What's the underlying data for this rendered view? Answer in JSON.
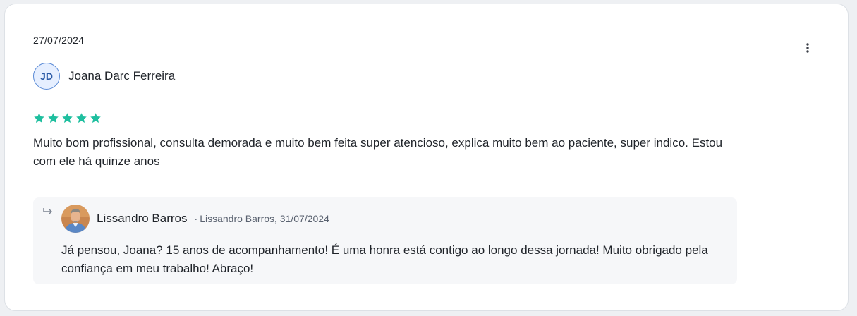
{
  "review": {
    "date": "27/07/2024",
    "author_initials": "JD",
    "author_name": "Joana Darc Ferreira",
    "rating": 5,
    "rating_max": 5,
    "text": "Muito bom profissional, consulta demorada e muito bem feita super atencioso, explica muito bem ao paciente, super indico. Estou com ele há quinze anos"
  },
  "reply": {
    "author_name": "Lissandro Barros",
    "meta_separator": "·",
    "meta": "Lissandro Barros, 31/07/2024",
    "text": "Já pensou, Joana? 15 anos de acompanhamento! É uma honra está contigo ao longo dessa jornada! Muito obrigado pela confiança em meu trabalho! Abraço!"
  },
  "icons": {
    "menu": "more-vertical-icon",
    "star": "star-icon",
    "reply": "reply-arrow-icon"
  },
  "colors": {
    "star": "#1fbf9f",
    "avatar_bg": "#e6efff",
    "avatar_border": "#5b8bd6",
    "reply_bg": "#f6f7f9"
  }
}
